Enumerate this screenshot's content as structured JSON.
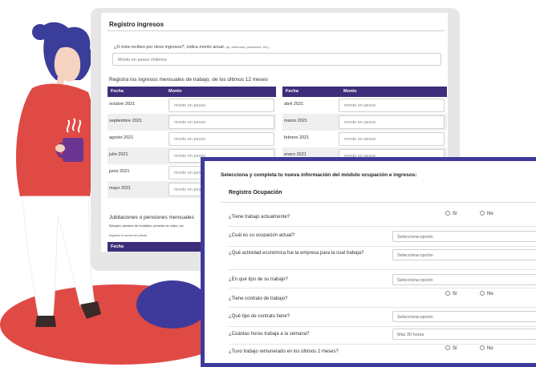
{
  "colors": {
    "accent": "#3e2d7a",
    "front_border": "#3e3a9c",
    "blob_red": "#e04a45",
    "hair_blue": "#3b3d9a"
  },
  "back_form": {
    "title": "Registro ingresos",
    "question": "¿O ésta recibes por otros ingresos?, indica monto anual.",
    "question_note": "(ej: arriendos, pensiones, etc.)",
    "input_placeholder": "Monto en pesos chilenos",
    "subtitle": "Registra los ingresos mensuales de trabajo, de los últimos 12 meses",
    "col_fecha": "Fecha",
    "col_monto": "Monto",
    "left_rows": [
      {
        "month": "octubre 2021",
        "placeholder": "monto en pesos"
      },
      {
        "month": "septiembre 2021",
        "placeholder": "monto en pesos"
      },
      {
        "month": "agosto 2021",
        "placeholder": "monto en pesos"
      },
      {
        "month": "julio 2021",
        "placeholder": "monto en pesos"
      },
      {
        "month": "junio 2021",
        "placeholder": "monto en pesos"
      },
      {
        "month": "mayo 2021",
        "placeholder": "monto en pesos"
      }
    ],
    "right_rows": [
      {
        "month": "abril 2021",
        "placeholder": "monto en pesos"
      },
      {
        "month": "marzo 2021",
        "placeholder": "monto en pesos"
      },
      {
        "month": "febrero 2021",
        "placeholder": "monto en pesos"
      },
      {
        "month": "enero 2021",
        "placeholder": "monto en pesos"
      }
    ],
    "jubilaciones_title": "Jubilaciones o pensiones mensuales",
    "ejemplo": "Ejemplo: pensión de invalidez, pensión de vejez, etc.",
    "ejemplo2": "Ingresa el monto en pesos",
    "col_fecha2": "Fecha"
  },
  "front_form": {
    "title": "Selecciona y completa tu nueva información del módulo ocupación e ingresos:",
    "section": "Registro Ocupación",
    "radio_si": "Sí",
    "radio_no": "No",
    "select_placeholder": "Selecciona opción",
    "hours_placeholder": "Más 30 horas",
    "questions": {
      "q1": "¿Tiene trabajo actualmente?",
      "q2": "¿Cuál es su ocupación actual?",
      "q3": "¿Qué actividad económica fue la empresa para la cual trabaja?",
      "q4": "¿En qué tipo de su trabajo?",
      "q5": "¿Tiene contrato de trabajo?",
      "q6": "¿Qué tipo de contrato tiene?",
      "q7": "¿Cuántas horas trabaja a la semana?",
      "q8": "¿Tuvo trabajo remunerado en los últimos 2 meses?"
    }
  }
}
